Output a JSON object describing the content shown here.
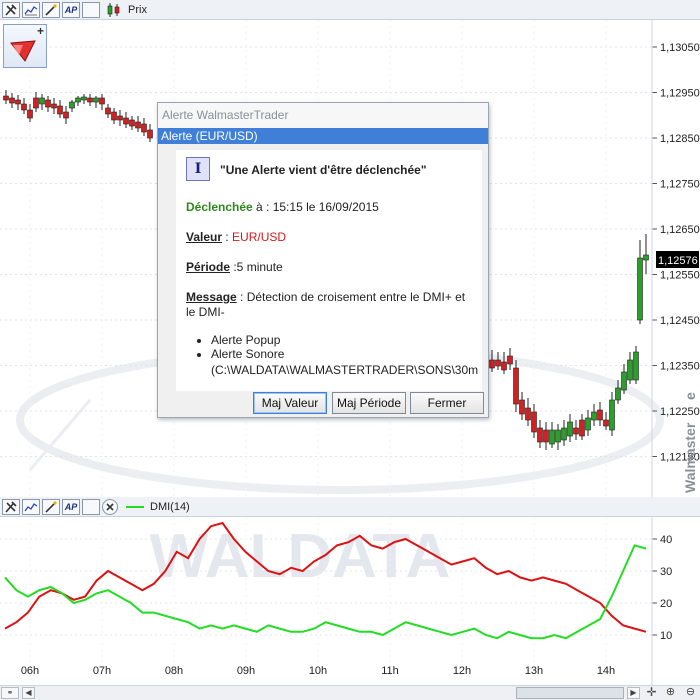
{
  "top_toolbar": {
    "buttons": [
      "tools-icon",
      "line-chart-icon",
      "wand-icon",
      "AP",
      "blank-square-icon"
    ],
    "ap_label": "AP",
    "series_label": "Prix"
  },
  "price_chart": {
    "y_ticks": [
      "1,13050",
      "1,12950",
      "1,12850",
      "1,12750",
      "1,12650",
      "1,12550",
      "1,12450",
      "1,12350",
      "1,12250",
      "1,12150"
    ],
    "last_price": "1,12576",
    "watermark_side": "Walmaster",
    "watermark_suffix": "e",
    "colors": {
      "up": "#2aa02a",
      "down": "#d42020"
    }
  },
  "indicator_toolbar": {
    "ap_label": "AP",
    "series_label": "DMI(14)"
  },
  "indicator_chart": {
    "y_ticks": [
      "40",
      "30",
      "20",
      "10"
    ],
    "x_ticks": [
      "06h",
      "07h",
      "08h",
      "09h",
      "10h",
      "11h",
      "12h",
      "13h",
      "14h"
    ],
    "watermark": "WALDATA",
    "colors": {
      "dmi_plus": "#22dd22",
      "dmi_minus": "#dd1111"
    }
  },
  "chart_data": {
    "type": "line",
    "title": "DMI(14)",
    "x": [
      "06h",
      "07h",
      "08h",
      "09h",
      "10h",
      "11h",
      "12h",
      "13h",
      "14h"
    ],
    "series": [
      {
        "name": "DMI+",
        "color": "#22dd22",
        "values": [
          28,
          24,
          17,
          12,
          13,
          14,
          11,
          9,
          38
        ]
      },
      {
        "name": "DMI-",
        "color": "#dd1111",
        "values": [
          12,
          23,
          27,
          45,
          30,
          39,
          36,
          28,
          11
        ]
      }
    ],
    "ylim": [
      0,
      45
    ]
  },
  "dialog": {
    "window_title": "Alerte WalmasterTrader",
    "subtitle": "Alerte (EUR/USD)",
    "icon_letter": "I",
    "headline": "\"Une Alerte vient d'être déclenchée\"",
    "triggered_label": "Déclenchée",
    "triggered_value": " à : 15:15 le 16/09/2015",
    "value_label": "Valeur",
    "value_sep": " : ",
    "value_value": "EUR/USD",
    "period_label": "Période",
    "period_value": " :5 minute",
    "message_label": "Message",
    "message_value_1": " : Détection de croisement entre le DMI+ et",
    "message_value_2": "le DMI-",
    "bullets": [
      "Alerte Popup",
      "Alerte Sonore",
      "(C:\\WALDATA\\WALMASTERTRADER\\SONS\\30m"
    ],
    "buttons": {
      "maj_valeur": "Maj Valeur",
      "maj_periode": "Maj Période",
      "fermer": "Fermer"
    }
  }
}
